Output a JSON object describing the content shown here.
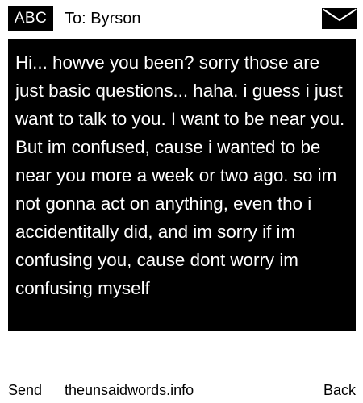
{
  "header": {
    "mode_badge": "ABC",
    "recipient_line": "To: Byrson",
    "envelope_icon": "envelope-icon"
  },
  "message": {
    "body": "Hi... howve you been? sorry those are just basic questions... haha. i guess i just want to talk to you. I want to be near you. But im confused, cause i wanted to be near you more a week or two ago. so im not gonna act on anything, even tho i accidentitally did, and im sorry if im confusing you, cause dont worry im confusing myself"
  },
  "footer": {
    "left_softkey": "Send",
    "center_text": "theunsaidwords.info",
    "right_softkey": "Back"
  },
  "colors": {
    "background": "#ffffff",
    "message_background": "#000000",
    "message_text": "#ffffff",
    "text": "#000000"
  }
}
